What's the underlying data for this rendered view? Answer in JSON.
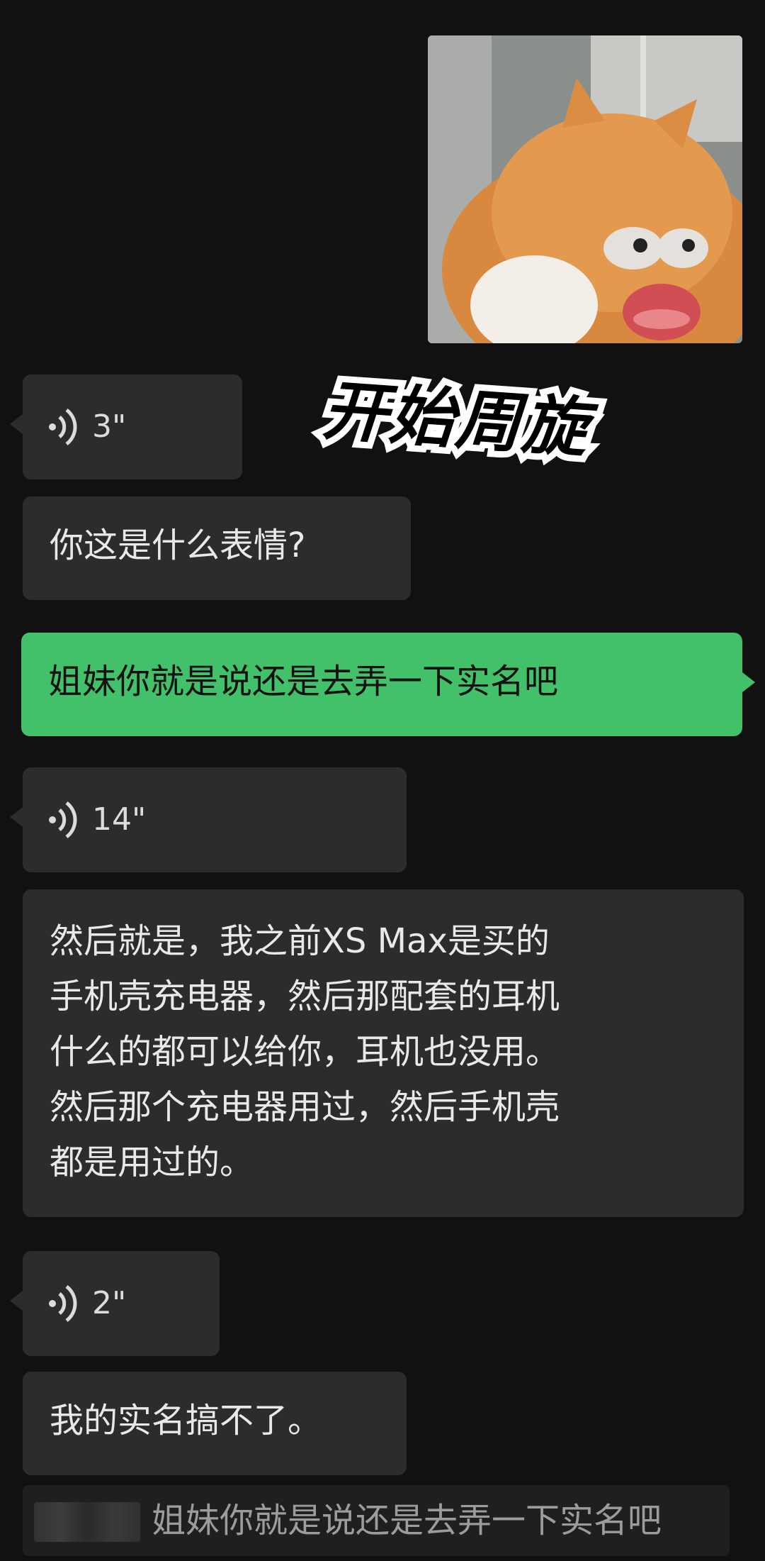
{
  "overlay_caption": "开始周旋",
  "messages": [
    {
      "type": "image",
      "side": "right",
      "icon": "cat-sticker-image"
    },
    {
      "type": "voice",
      "side": "left",
      "duration": "3\""
    },
    {
      "type": "text",
      "side": "left",
      "text": "你这是什么表情?"
    },
    {
      "type": "text",
      "side": "right",
      "text": "姐妹你就是说还是去弄一下实名吧"
    },
    {
      "type": "voice",
      "side": "left",
      "duration": "14\""
    },
    {
      "type": "text",
      "side": "left",
      "lines": [
        "然后就是，我之前XS Max是买的",
        "手机壳充电器，然后那配套的耳机",
        "什么的都可以给你，耳机也没用。",
        "然后那个充电器用过，然后手机壳",
        "都是用过的。"
      ]
    },
    {
      "type": "voice",
      "side": "left",
      "duration": "2\""
    },
    {
      "type": "text",
      "side": "left",
      "text": "我的实名搞不了。"
    }
  ],
  "reply_quote": "姐妹你就是说还是去弄一下实名吧",
  "colors": {
    "background": "#111111",
    "incoming_bubble": "#2c2c2c",
    "outgoing_bubble": "#42c06a"
  }
}
